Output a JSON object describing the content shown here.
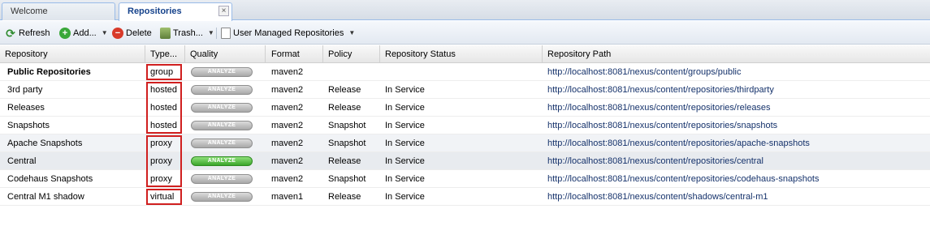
{
  "tabs": [
    {
      "label": "Welcome"
    },
    {
      "label": "Repositories"
    }
  ],
  "toolbar": {
    "refresh_label": "Refresh",
    "add_label": "Add...",
    "delete_label": "Delete",
    "trash_label": "Trash...",
    "user_managed_label": "User Managed Repositories"
  },
  "columns": {
    "repository": "Repository",
    "type": "Type...",
    "quality": "Quality",
    "format": "Format",
    "policy": "Policy",
    "status": "Repository Status",
    "path": "Repository Path"
  },
  "analyze_label": "ANALYZE",
  "colors": {
    "highlight_box": "#d01f1f",
    "analyze_active": "#3aa52a",
    "link_text": "#15326b"
  },
  "rows": [
    {
      "name": "Public Repositories",
      "type": "group",
      "format": "maven2",
      "policy": "",
      "status": "",
      "path": "http://localhost:8081/nexus/content/groups/public",
      "bold": true,
      "analyze_active": false
    },
    {
      "name": "3rd party",
      "type": "hosted",
      "format": "maven2",
      "policy": "Release",
      "status": "In Service",
      "path": "http://localhost:8081/nexus/content/repositories/thirdparty",
      "bold": false,
      "analyze_active": false
    },
    {
      "name": "Releases",
      "type": "hosted",
      "format": "maven2",
      "policy": "Release",
      "status": "In Service",
      "path": "http://localhost:8081/nexus/content/repositories/releases",
      "bold": false,
      "analyze_active": false
    },
    {
      "name": "Snapshots",
      "type": "hosted",
      "format": "maven2",
      "policy": "Snapshot",
      "status": "In Service",
      "path": "http://localhost:8081/nexus/content/repositories/snapshots",
      "bold": false,
      "analyze_active": false
    },
    {
      "name": "Apache Snapshots",
      "type": "proxy",
      "format": "maven2",
      "policy": "Snapshot",
      "status": "In Service",
      "path": "http://localhost:8081/nexus/content/repositories/apache-snapshots",
      "bold": false,
      "analyze_active": false
    },
    {
      "name": "Central",
      "type": "proxy",
      "format": "maven2",
      "policy": "Release",
      "status": "In Service",
      "path": "http://localhost:8081/nexus/content/repositories/central",
      "bold": false,
      "analyze_active": true
    },
    {
      "name": "Codehaus Snapshots",
      "type": "proxy",
      "format": "maven2",
      "policy": "Snapshot",
      "status": "In Service",
      "path": "http://localhost:8081/nexus/content/repositories/codehaus-snapshots",
      "bold": false,
      "analyze_active": false
    },
    {
      "name": "Central M1 shadow",
      "type": "virtual",
      "format": "maven1",
      "policy": "Release",
      "status": "In Service",
      "path": "http://localhost:8081/nexus/content/shadows/central-m1",
      "bold": false,
      "analyze_active": false
    }
  ]
}
